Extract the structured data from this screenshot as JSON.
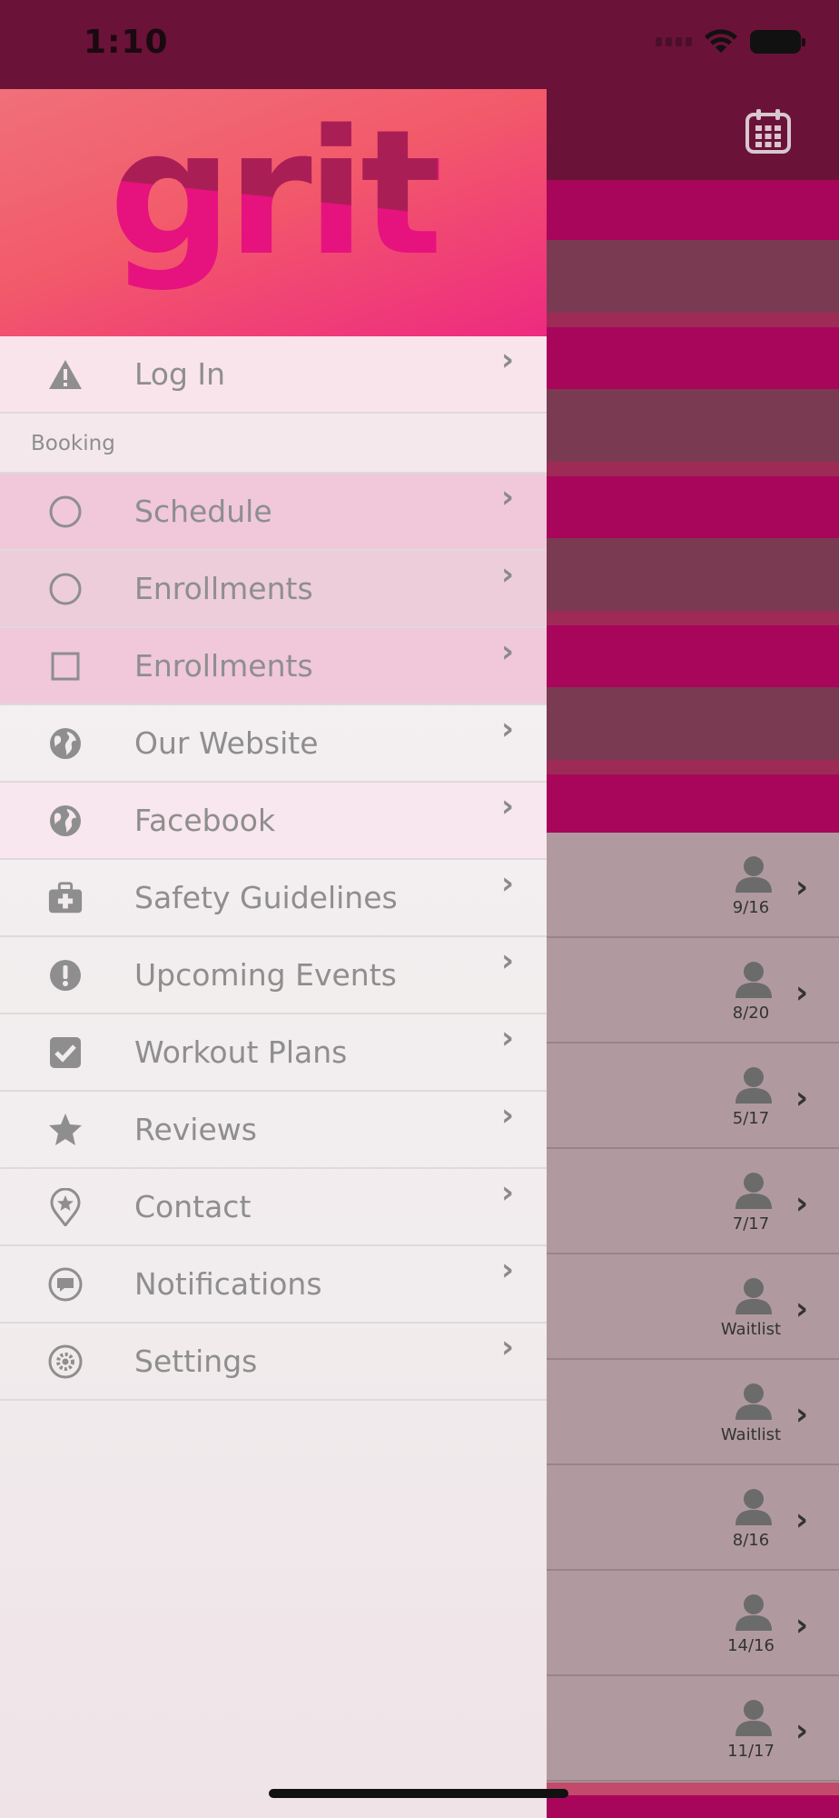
{
  "status": {
    "time": "1:10"
  },
  "app": {
    "logo_text": "grit"
  },
  "menu": {
    "items": [
      {
        "label": "Log In",
        "icon": "warning-icon"
      },
      {
        "section": "Booking"
      },
      {
        "label": "Schedule",
        "icon": "circle-icon"
      },
      {
        "label": "Enrollments",
        "icon": "circle-icon"
      },
      {
        "label": "Enrollments",
        "icon": "square-icon"
      },
      {
        "label": "Our Website",
        "icon": "globe-icon"
      },
      {
        "label": "Facebook",
        "icon": "globe-icon"
      },
      {
        "label": "Safety Guidelines",
        "icon": "first-aid-kit-icon"
      },
      {
        "label": "Upcoming Events",
        "icon": "exclamation-icon"
      },
      {
        "label": "Workout Plans",
        "icon": "checkbox-icon"
      },
      {
        "label": "Reviews",
        "icon": "star-icon"
      },
      {
        "label": "Contact",
        "icon": "location-star-icon"
      },
      {
        "label": "Notifications",
        "icon": "chat-bubble-icon"
      },
      {
        "label": "Settings",
        "icon": "gear-icon"
      }
    ]
  },
  "classes": {
    "rows": [
      {
        "count": "9/16"
      },
      {
        "count": "8/20"
      },
      {
        "count": "5/17"
      },
      {
        "count": "7/17"
      },
      {
        "count": "Waitlist"
      },
      {
        "count": "Waitlist"
      },
      {
        "count": "8/16"
      },
      {
        "count": "14/16"
      },
      {
        "count": "11/17"
      }
    ]
  },
  "colors": {
    "brand_pink": "#e6127e",
    "header_dark": "#6b1238",
    "accent_magenta": "#a8065b"
  }
}
